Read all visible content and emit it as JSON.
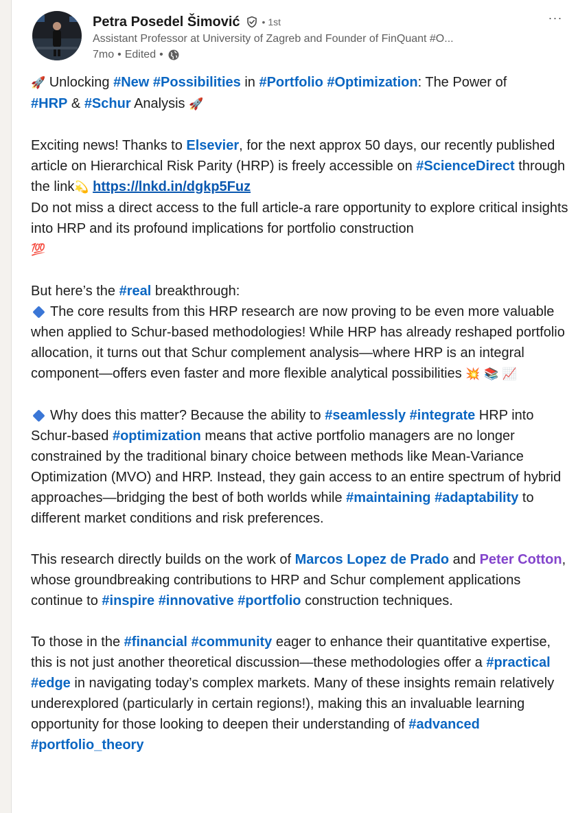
{
  "author": {
    "name": "Petra Posedel Šimović",
    "degree": "• 1st",
    "headline": "Assistant Professor at University of Zagreb and Founder of FinQuant #O...",
    "time": "7mo",
    "edited": "Edited",
    "sep": "•"
  },
  "icons": {
    "verified": "verified-shield-icon",
    "visibility": "globe-icon",
    "more": "more-horizontal-icon"
  },
  "more_label": "···",
  "colors": {
    "hashtag": "#0a66c2",
    "mention_purple": "#8344cc",
    "text": "#1d1d1d",
    "meta": "#5e5e5e"
  },
  "post": {
    "p1": {
      "e1": "🚀",
      "t1": " Unlocking ",
      "h1": "#New",
      "h2": "#Possibilities",
      "t2": " in ",
      "h3": "#Portfolio",
      "h4": "#Optimization",
      "t3": ": The Power of ",
      "h5": "#HRP",
      "t4": " & ",
      "h6": "#Schur",
      "t5": " Analysis ",
      "e2": "🚀"
    },
    "p2": {
      "t1": "Exciting news! Thanks to ",
      "m1": "Elsevier",
      "t2": ", for the next approx 50 days, our recently published article on Hierarchical Risk Parity (HRP) is freely accessible on ",
      "h1": "#ScienceDirect",
      "t3": " through the link",
      "e1": "💫",
      "link": "https://lnkd.in/dgkp5Fuz",
      "t4": "Do not miss a direct access to the full article-a rare opportunity to explore critical insights into HRP and its profound implications for portfolio construction ",
      "e2": "💯"
    },
    "p3": {
      "t1": "But here’s the ",
      "h1": "#real",
      "t2": " breakthrough:",
      "t3": "The core results from this HRP research are now proving to be even more valuable when applied to Schur-based methodologies! While HRP has already reshaped portfolio allocation, it turns out that Schur complement analysis—where HRP is an integral component—offers even faster and more flexible analytical possibilities ",
      "e1": "💥",
      "e2": "📚",
      "e3": "📈"
    },
    "p4": {
      "t1": "Why does this matter? Because the ability to ",
      "h1": "#seamlessly",
      "h2": "#integrate",
      "t2": " HRP into Schur-based ",
      "h3": "#optimization",
      "t3": " means that active portfolio managers are no longer constrained by the traditional binary choice between methods like Mean-Variance Optimization (MVO) and HRP. Instead, they gain access to an entire spectrum of hybrid approaches—bridging the best of both worlds while ",
      "h4": "#maintaining",
      "h5": "#adaptability",
      "t4": " to different market conditions and risk preferences."
    },
    "p5": {
      "t1": "This research directly builds on the work of ",
      "m1": "Marcos Lopez de Prado",
      "t2": " and ",
      "m2": "Peter Cotton",
      "t3": ", whose groundbreaking contributions to HRP and Schur complement applications continue to ",
      "h1": "#inspire",
      "h2": "#innovative",
      "h3": "#portfolio",
      "t4": " construction techniques."
    },
    "p6": {
      "t1": "To those in the ",
      "h1": "#financial",
      "h2": "#community",
      "t2": " eager to enhance their quantitative expertise, this is not just another theoretical discussion—these methodologies offer a ",
      "h3": "#practical",
      "h4": "#edge",
      "t3": " in navigating today’s complex markets. Many of these insights remain relatively underexplored (particularly in certain regions!), making this an invaluable learning opportunity for those looking to deepen their understanding of ",
      "h5": "#advanced",
      "h6": "#portfolio_theory"
    }
  }
}
